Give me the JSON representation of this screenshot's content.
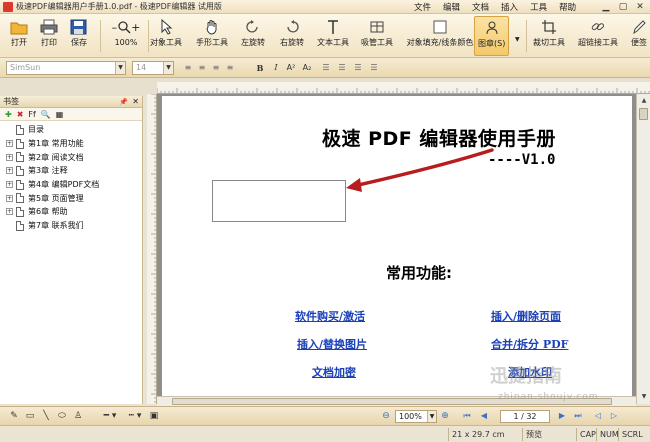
{
  "window": {
    "title": "极速PDF编辑器用户手册1.0.pdf - 极速PDF编辑器 试用版",
    "menu": [
      "文件",
      "编辑",
      "文档",
      "插入",
      "工具",
      "帮助"
    ]
  },
  "toolbar": {
    "open": "打开",
    "print": "打印",
    "save": "保存",
    "zoom_value": "100%",
    "object_tool": "对象工具",
    "hand_tool": "手形工具",
    "rotate_left": "左旋转",
    "rotate_right": "右旋转",
    "text_tool": "文本工具",
    "snap_tool": "吸管工具",
    "fill_tool": "对象填充/线条颜色",
    "shape_tool": "图章(S)",
    "crop_tool": "裁切工具",
    "link_tool": "超链接工具",
    "extra_tool": "便签"
  },
  "format": {
    "font_name": "SimSun",
    "font_size": "14",
    "bold": "B",
    "italic": "I",
    "sup": "A²",
    "sub": "A₂"
  },
  "bookmarks": {
    "title": "书签",
    "items": [
      {
        "label": "目录",
        "expandable": false
      },
      {
        "label": "第1章 常用功能",
        "expandable": true
      },
      {
        "label": "第2章 阅读文档",
        "expandable": true
      },
      {
        "label": "第3章 注释",
        "expandable": true
      },
      {
        "label": "第4章 编辑PDF文档",
        "expandable": true
      },
      {
        "label": "第5章 页面管理",
        "expandable": true
      },
      {
        "label": "第6章 帮助",
        "expandable": true
      },
      {
        "label": "第7章 联系我们",
        "expandable": false
      }
    ]
  },
  "document": {
    "title": "极速 PDF 编辑器使用手册",
    "version": "----V1.0",
    "section_heading": "常用功能:",
    "links": [
      {
        "text": "软件购买/激活"
      },
      {
        "text": "插入/删除页面"
      },
      {
        "text": "插入/替换图片"
      },
      {
        "text": "合并/拆分 PDF"
      },
      {
        "text": "文档加密"
      },
      {
        "text": "添加水印"
      }
    ]
  },
  "navigation": {
    "zoom": "100%",
    "page_indicator": "1 / 32"
  },
  "status": {
    "page_size": "21 x 29.7 cm",
    "mode": "预览",
    "cap": "CAP",
    "num": "NUM",
    "scrl": "SCRL"
  },
  "watermark": {
    "text": "迅捷指南",
    "url": "zhinan.shoujv.com"
  },
  "colors": {
    "link": "#1a40b8",
    "arrow": "#b81c1c",
    "ribbon": "#f1e3c3"
  }
}
